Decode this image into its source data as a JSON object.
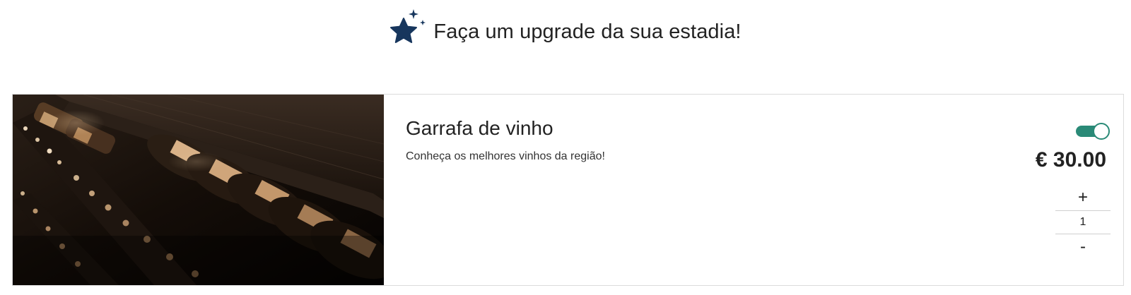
{
  "header": {
    "title": "Faça um upgrade da sua estadia!",
    "icon": "sparkle-star-icon",
    "icon_color": "#17365d"
  },
  "product": {
    "name": "Garrafa de vinho",
    "description": "Conheça os melhores vinhos da região!",
    "image": "wine-bottles-cellar-photo",
    "enabled": true,
    "price": "€ 30.00",
    "quantity": "1",
    "increment_label": "+",
    "decrement_label": "-",
    "toggle_color": "#2a8a77"
  }
}
